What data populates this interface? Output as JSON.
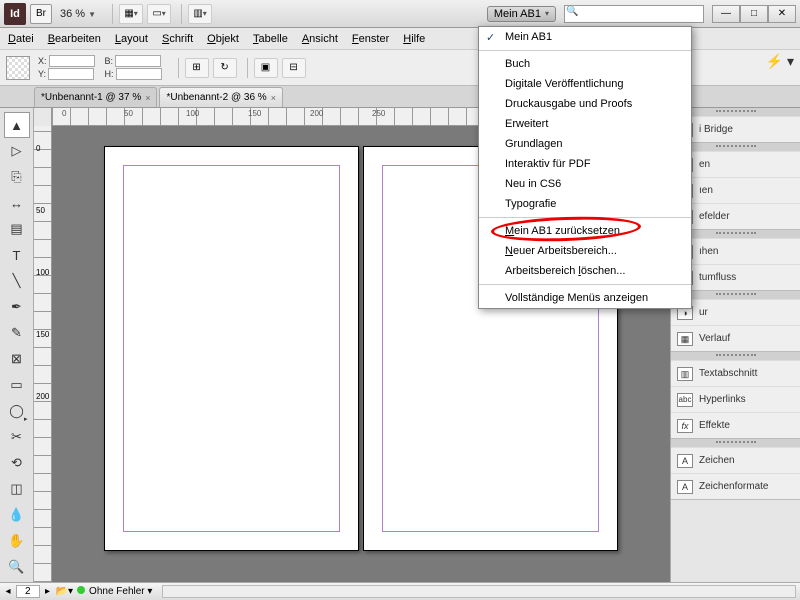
{
  "title": {
    "app": "Id",
    "bridge": "Br",
    "zoom": "36 %"
  },
  "workspace": {
    "button": "Mein AB1"
  },
  "winctrls": {
    "min": "—",
    "max": "□",
    "close": "✕"
  },
  "menu": {
    "file": "Datei",
    "edit": "Bearbeiten",
    "layout": "Layout",
    "type": "Schrift",
    "object": "Objekt",
    "table": "Tabelle",
    "view": "Ansicht",
    "window": "Fenster",
    "help": "Hilfe"
  },
  "ctrl": {
    "x": "X:",
    "y": "Y:",
    "w": "B:",
    "h": "H:"
  },
  "tabs": {
    "t1": "*Unbenannt-1 @ 37 %",
    "t2": "*Unbenannt-2 @ 36 %"
  },
  "ruler": {
    "h0": "0",
    "h50": "50",
    "h100": "100",
    "h150": "150",
    "h200": "200",
    "h250": "250",
    "v0": "0",
    "v50": "50",
    "v100": "100",
    "v150": "150",
    "v200": "200"
  },
  "dropdown": {
    "i0": "Mein AB1",
    "i1": "Buch",
    "i2": "Digitale Veröffentlichung",
    "i3": "Druckausgabe und Proofs",
    "i4": "Erweitert",
    "i5": "Grundlagen",
    "i6": "Interaktiv für PDF",
    "i7": "Neu in CS6",
    "i8": "Typografie",
    "i9": "Mein AB1 zurücksetzen",
    "i10": "Neuer Arbeitsbereich...",
    "i11": "Arbeitsbereich löschen...",
    "i12": "Vollständige Menüs anzeigen"
  },
  "panels": {
    "p0": "i Bridge",
    "p1": "en",
    "p2": "ıen",
    "p3": "efelder",
    "p4": "ıhen",
    "p5": "tumfluss",
    "p6": "ur",
    "p7": "Verlauf",
    "p8": "Textabschnitt",
    "p9": "Hyperlinks",
    "p10": "Effekte",
    "p11": "Zeichen",
    "p12": "Zeichenformate"
  },
  "status": {
    "page": "2",
    "errors": "Ohne Fehler"
  }
}
